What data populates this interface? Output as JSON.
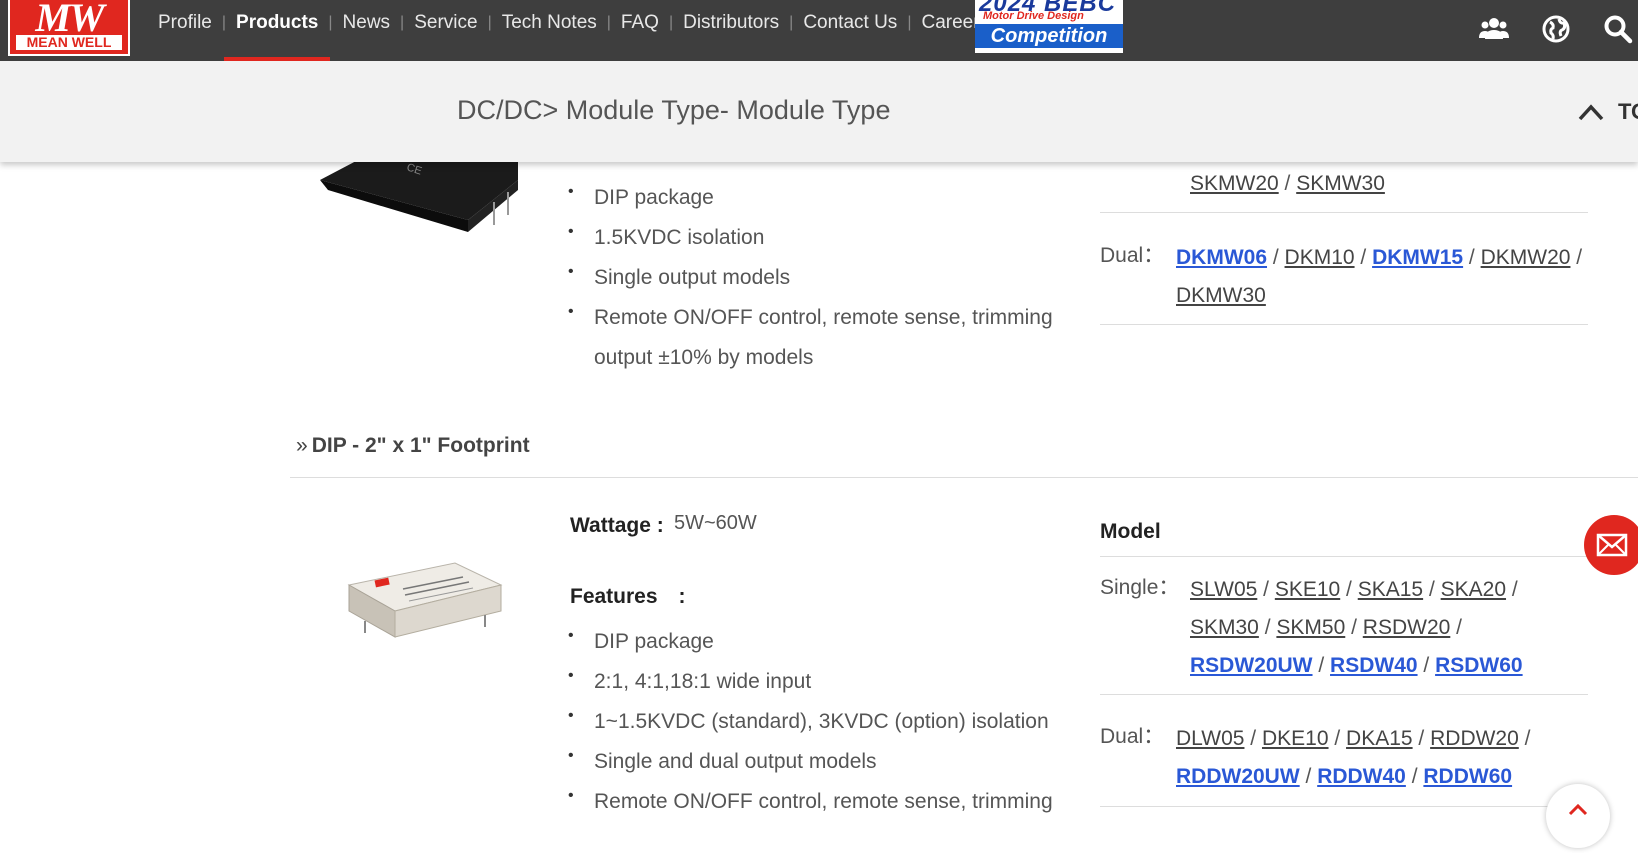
{
  "brand": {
    "logo_mark": "MW",
    "logo_text": "MEAN WELL"
  },
  "nav": {
    "items": [
      "Profile",
      "Products",
      "News",
      "Service",
      "Tech Notes",
      "FAQ",
      "Distributors",
      "Contact Us",
      "Career"
    ],
    "active": "Products"
  },
  "banner": {
    "line1": "2024 BEBC",
    "line2": "Motor Drive Design",
    "line3": "Competition"
  },
  "icons": {
    "community": "users-icon",
    "language": "globe-icon",
    "search": "search-icon",
    "contact": "mail-icon",
    "back_to_top": "chevron-up-icon"
  },
  "subheader": {
    "title": "DC/DC> Module Type- Module Type",
    "top_label": "TOP"
  },
  "section1": {
    "features": [
      "DIP package",
      "1.5KVDC isolation",
      "Single output models",
      "Remote ON/OFF control, remote sense, trimming output ±10% by models"
    ],
    "single_tail": [
      "SKMW20",
      "SKMW30"
    ],
    "dual_label": "Dual：",
    "dual": [
      {
        "name": "DKMW06",
        "hl": true
      },
      {
        "name": "DKM10",
        "hl": false
      },
      {
        "name": "DKMW15",
        "hl": true
      },
      {
        "name": "DKMW20",
        "hl": false
      },
      {
        "name": "DKMW30",
        "hl": false
      }
    ]
  },
  "section2": {
    "title": "DIP - 2\" x 1\" Footprint",
    "wattage_label": "Wattage :",
    "wattage_value": "5W~60W",
    "features_label": "Features　:",
    "features": [
      "DIP package",
      "2:1, 4:1,18:1 wide input",
      "1~1.5KVDC (standard), 3KVDC (option) isolation",
      "Single and dual output models",
      "Remote ON/OFF control, remote sense, trimming"
    ],
    "model_label": "Model",
    "single_label": "Single：",
    "single": [
      {
        "name": "SLW05",
        "hl": false
      },
      {
        "name": "SKE10",
        "hl": false
      },
      {
        "name": "SKA15",
        "hl": false
      },
      {
        "name": "SKA20",
        "hl": false
      },
      {
        "name": "SKM30",
        "hl": false
      },
      {
        "name": "SKM50",
        "hl": false
      },
      {
        "name": "RSDW20",
        "hl": false
      },
      {
        "name": "RSDW20UW",
        "hl": true
      },
      {
        "name": "RSDW40",
        "hl": true
      },
      {
        "name": "RSDW60",
        "hl": true
      }
    ],
    "dual_label": "Dual：",
    "dual": [
      {
        "name": "DLW05",
        "hl": false
      },
      {
        "name": "DKE10",
        "hl": false
      },
      {
        "name": "DKA15",
        "hl": false
      },
      {
        "name": "RDDW20",
        "hl": false
      },
      {
        "name": "RDDW20UW",
        "hl": true
      },
      {
        "name": "RDDW40",
        "hl": true
      },
      {
        "name": "RDDW60",
        "hl": true
      }
    ]
  },
  "colors": {
    "brand_red": "#e0271f",
    "nav_bg": "#3e3e3e",
    "link_highlight": "#2a58d6"
  }
}
